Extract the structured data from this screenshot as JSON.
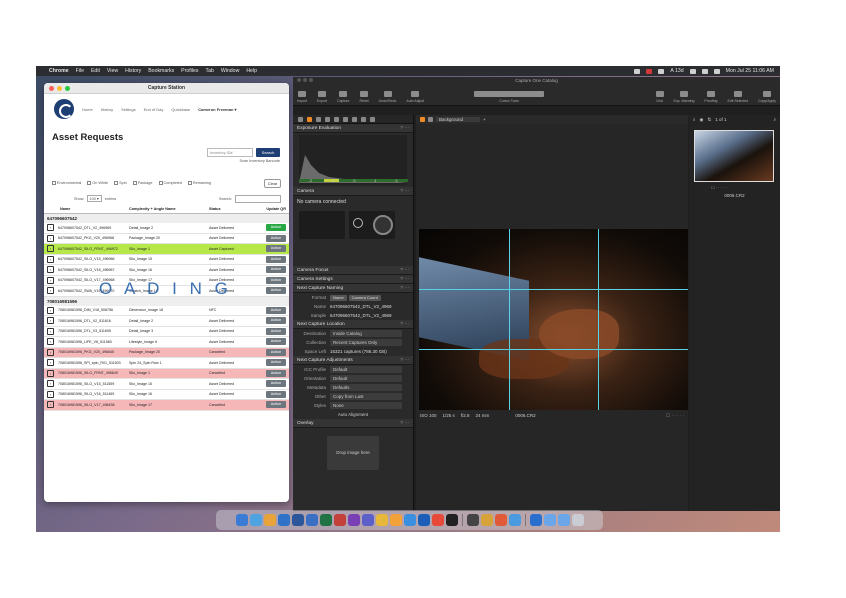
{
  "menubar": {
    "app": "Chrome",
    "items": [
      "File",
      "Edit",
      "View",
      "History",
      "Bookmarks",
      "Profiles",
      "Tab",
      "Window",
      "Help"
    ],
    "clock": "Mon Jul 25  11:06 AM",
    "disk": "A 13d"
  },
  "capture_station": {
    "window_title": "Capture Station",
    "nav": [
      "Home",
      "History",
      "Settings",
      "End of Day",
      "Quickbase"
    ],
    "user": "Cameron Freeman ▾",
    "heading": "Asset Requests",
    "inventory_placeholder": "Inventory ID#",
    "search_button": "Search",
    "scan_link": "Scan Inventory Barcode",
    "filters": [
      "Environmental",
      "On White",
      "Spin",
      "Package",
      "Completed",
      "Remaining"
    ],
    "clear_button": "Clear",
    "show_label": "Show",
    "show_value": "100",
    "entries_label": "entries",
    "search_label": "Search:",
    "columns": [
      "Name",
      "Complexity + Angle Name",
      "Status",
      "Update QR"
    ],
    "overlay_text": "O A D I N G",
    "groups": [
      {
        "id": "647096607542",
        "rows": [
          {
            "name": "647096607542_DTL_V2_496969",
            "angle": "Detail_Image 2",
            "status": "Asset Delivered",
            "action": "Action",
            "hl": "",
            "action_style": "g"
          },
          {
            "name": "647096607542_PKG_V20_496968",
            "angle": "Package_Image 20",
            "status": "Asset Delivered",
            "action": "Action",
            "hl": "",
            "action_style": ""
          },
          {
            "name": "647096607542_SILO_FRNT_496972",
            "angle": "Silo_Image 1",
            "status": "Asset Captured",
            "action": "Action",
            "hl": "green",
            "action_style": ""
          },
          {
            "name": "647096607542_SILO_V15_496966",
            "angle": "Silo_Image 15",
            "status": "Asset Delivered",
            "action": "Action",
            "hl": "",
            "action_style": ""
          },
          {
            "name": "647096607542_SILO_V16_496967",
            "angle": "Silo_Image 16",
            "status": "Asset Delivered",
            "action": "Action",
            "hl": "",
            "action_style": ""
          },
          {
            "name": "647096607542_SILO_V17_496968",
            "angle": "Silo_Image 17",
            "status": "Asset Delivered",
            "action": "Action",
            "hl": "",
            "action_style": ""
          },
          {
            "name": "647096607542_SWA_V19_496970",
            "angle": "Swatch_Image 19",
            "status": "Asset Delivered",
            "action": "Action",
            "hl": "",
            "action_style": ""
          }
        ]
      },
      {
        "id": "708016981596",
        "rows": [
          {
            "name": "708016981596_DIM_V18_508756",
            "angle": "Dimension_Image 18",
            "status": "NFC",
            "action": "Action",
            "hl": "",
            "action_style": ""
          },
          {
            "name": "708016981596_DTL_V2_511616",
            "angle": "Detail_Image 2",
            "status": "Asset Delivered",
            "action": "Action",
            "hl": "",
            "action_style": ""
          },
          {
            "name": "708016981596_DTL_V3_511605",
            "angle": "Detail_Image 3",
            "status": "Asset Delivered",
            "action": "Action",
            "hl": "",
            "action_style": ""
          },
          {
            "name": "708016981596_LIFE_V6_511560",
            "angle": "Lifestyle_Image 6",
            "status": "Asset Delivered",
            "action": "Action",
            "hl": "",
            "action_style": ""
          },
          {
            "name": "708016981596_PKG_V20_496645",
            "angle": "Package_Image 20",
            "status": "Cancelled",
            "action": "Action",
            "hl": "red",
            "action_style": ""
          },
          {
            "name": "708016981596_SPI_spin_R01_511503",
            "angle": "Spin 24_Spin Row 1",
            "status": "Asset Delivered",
            "action": "Action",
            "hl": "",
            "action_style": ""
          },
          {
            "name": "708016981596_SILO_FRNT_496649",
            "angle": "Silo_Image 1",
            "status": "Cancelled",
            "action": "Action",
            "hl": "red",
            "action_style": ""
          },
          {
            "name": "708016981596_SILO_V15_511559",
            "angle": "Silo_Image 15",
            "status": "Asset Delivered",
            "action": "Action",
            "hl": "",
            "action_style": ""
          },
          {
            "name": "708016981596_SILO_V16_511469",
            "angle": "Silo_Image 16",
            "status": "Asset Delivered",
            "action": "Action",
            "hl": "",
            "action_style": ""
          },
          {
            "name": "708016981596_SILO_V17_496438",
            "angle": "Silo_Image 17",
            "status": "Cancelled",
            "action": "Action",
            "hl": "red",
            "action_style": ""
          }
        ]
      }
    ]
  },
  "capture_one": {
    "window_title": "Capture One Catalog",
    "toolbar_left": [
      "Import",
      "Export",
      "Capture",
      "Reset",
      "Undo/Redo",
      "Auto Adjust"
    ],
    "toolbar_center": "Cursor Tools",
    "toolbar_right": [
      "Grid",
      "Exp. Warning",
      "Proofing",
      "Edit Selected",
      "Copy/Apply"
    ],
    "panels": {
      "exposure": "Exposure Evaluation",
      "histo_labels": [
        "-2",
        "-1",
        "0",
        "1",
        "2"
      ],
      "camera": "Camera",
      "camera_status": "No camera connected",
      "camera_focus": "Camera Focus",
      "camera_settings": "Camera Settings",
      "next_naming": "Next Capture Naming",
      "format_label": "Format",
      "format_pills": [
        "Name",
        "Camera Count"
      ],
      "name_label": "Name",
      "name_value": "647096607542_DTL_V2_4969",
      "sample_label": "Sample",
      "sample_value": "647096607542_DTL_V2_4969",
      "next_location": "Next Capture Location",
      "destination_label": "Destination",
      "destination_value": "Inside Catalog",
      "collection_label": "Collection",
      "collection_value": "Recent Captures Only",
      "space_label": "Space Left",
      "space_value": "15321 captures (786.30 GB)",
      "next_adjust": "Next Capture Adjustments",
      "icc_label": "ICC Profile",
      "icc_value": "Default",
      "orient_label": "Orientation",
      "orient_value": "Default",
      "metadata_label": "Metadata",
      "metadata_value": "Defaults",
      "other_label": "Other",
      "other_value": "Copy from Last",
      "styles_label": "Styles",
      "styles_value": "None",
      "auto_align": "Auto Alignment",
      "overlay": "Overlay",
      "drop_image": "Drop image here"
    },
    "viewer": {
      "background": "Background",
      "meta_iso": "ISO 100",
      "meta_shutter": "1/25 s",
      "meta_aperture": "f/2.8",
      "meta_focal": "24 mm",
      "meta_file": "0006.CR2"
    },
    "browser": {
      "count": "1 of 1",
      "thumb_name": "0006.CR2"
    }
  },
  "colors": {
    "accent_blue": "#1d3f73",
    "row_green": "#b6e84a",
    "row_red": "#f6b7b9",
    "grid_cyan": "#57d3e8"
  }
}
